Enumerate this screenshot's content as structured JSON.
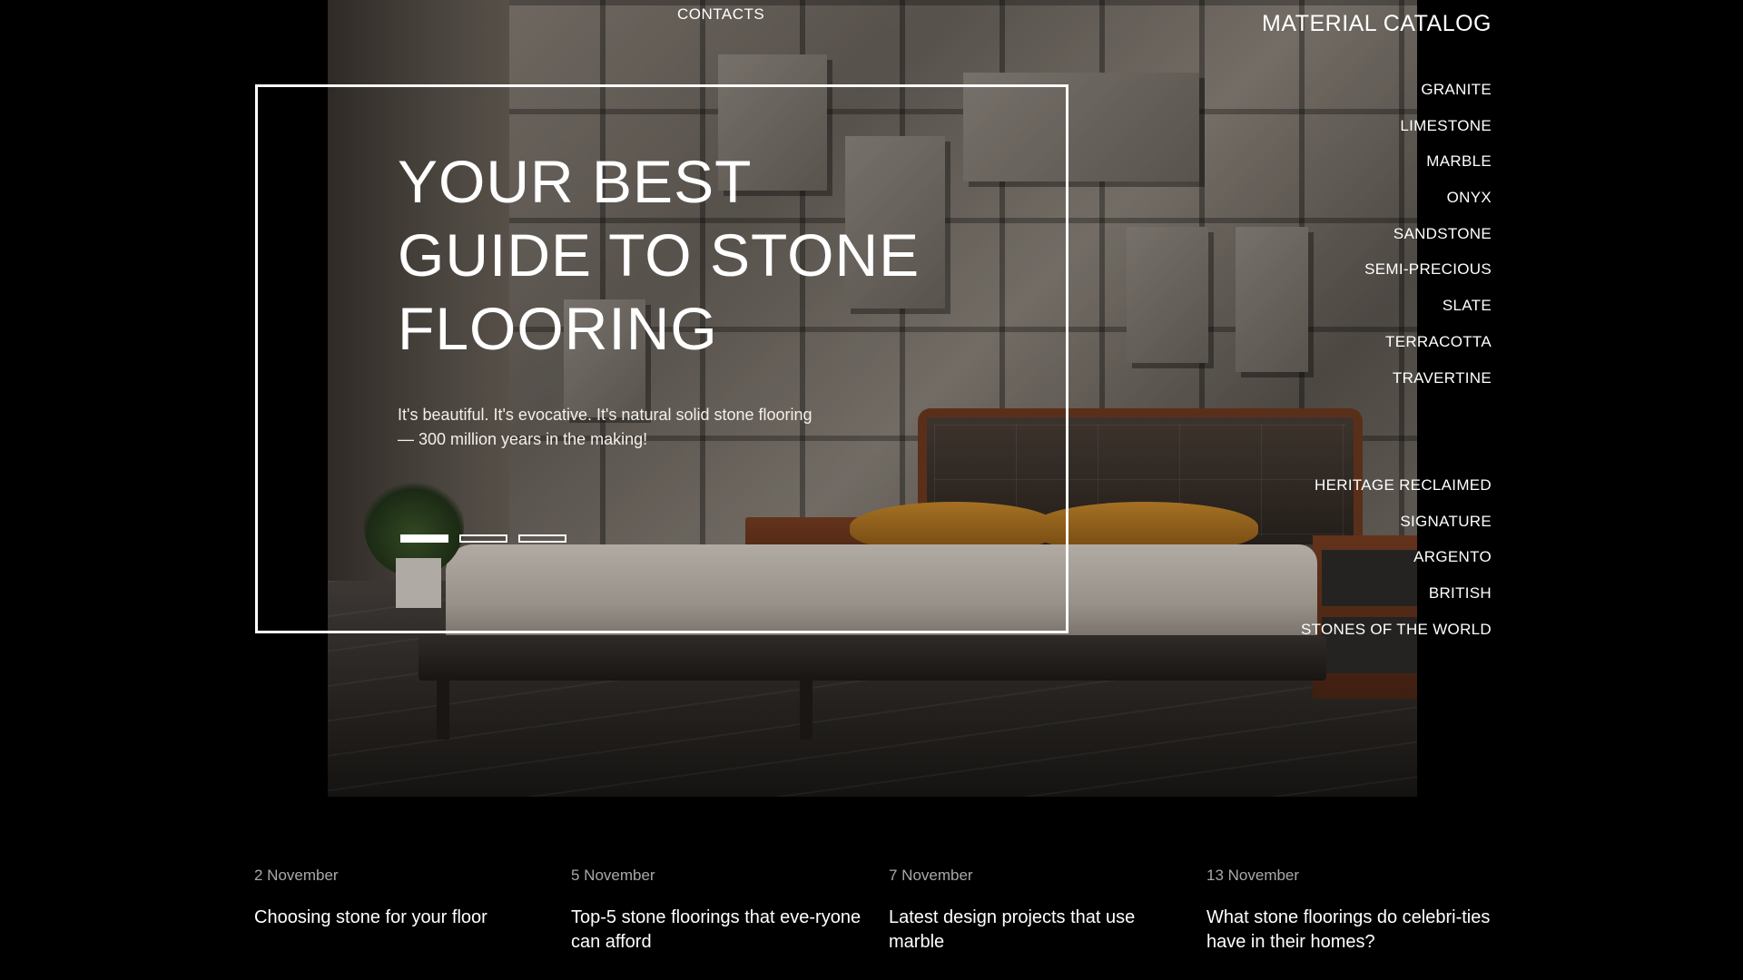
{
  "header": {
    "contacts_label": "CONTACTS"
  },
  "hero": {
    "title": "YOUR BEST\nGUIDE TO STONE\nFLOORING",
    "subtitle": "It's beautiful. It's evocative. It's natural solid stone flooring — 300 million years in the making!",
    "slides_total": 3,
    "active_slide": 1
  },
  "catalog": {
    "title": "MATERIAL CATALOG",
    "materials": [
      "GRANITE",
      "LIMESTONE",
      "MARBLE",
      "ONYX",
      "SANDSTONE",
      "SEMI-PRECIOUS",
      "SLATE",
      "TERRACOTTA",
      "TRAVERTINE"
    ],
    "collections": [
      "HERITAGE RECLAIMED",
      "SIGNATURE",
      "ARGENTO",
      "BRITISH",
      "STONES OF THE WORLD"
    ]
  },
  "news": [
    {
      "date": "2 November",
      "title": "Choosing stone for your floor"
    },
    {
      "date": "5 November",
      "title": "Top-5 stone floorings that eve-ryone can afford"
    },
    {
      "date": "7 November",
      "title": "Latest design projects that use marble"
    },
    {
      "date": "13 November",
      "title": "What stone floorings do celebri-ties have in their homes?"
    }
  ],
  "colors": {
    "background": "#000000",
    "text": "#ffffff",
    "date_text": "#a8a8a8",
    "pillow_accent": "#c98a2c",
    "wood_accent": "#7a3e22"
  }
}
